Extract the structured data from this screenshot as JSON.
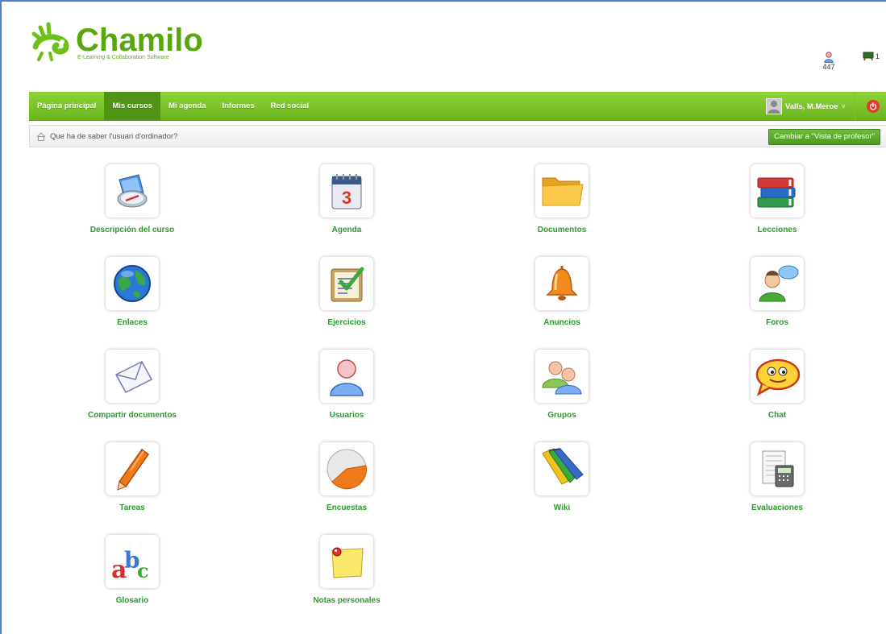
{
  "header": {
    "logo_name": "Chamilo",
    "logo_tagline": "E-Learning & Collaboration Software",
    "online_users": "447",
    "messages": "1"
  },
  "nav": {
    "items": [
      {
        "label": "Página principal",
        "active": false
      },
      {
        "label": "Mis cursos",
        "active": true
      },
      {
        "label": "Mi agenda",
        "active": false
      },
      {
        "label": "Informes",
        "active": false
      },
      {
        "label": "Red social",
        "active": false
      }
    ],
    "user_name": "Valls, M.Meroe",
    "user_caret": "˅"
  },
  "breadcrumb": {
    "course_title": "Que ha de saber l'usuari d'ordinador?",
    "switch_label": "Cambiar a \"Vista de profesor\""
  },
  "tools": [
    {
      "label": "Descripción del curso",
      "icon": "course-description-icon"
    },
    {
      "label": "Agenda",
      "icon": "agenda-icon"
    },
    {
      "label": "Documentos",
      "icon": "documents-icon"
    },
    {
      "label": "Lecciones",
      "icon": "lessons-icon"
    },
    {
      "label": "Enlaces",
      "icon": "links-icon"
    },
    {
      "label": "Ejercicios",
      "icon": "exercises-icon"
    },
    {
      "label": "Anuncios",
      "icon": "announcements-icon"
    },
    {
      "label": "Foros",
      "icon": "forums-icon"
    },
    {
      "label": "Compartir documentos",
      "icon": "dropbox-icon"
    },
    {
      "label": "Usuarios",
      "icon": "users-icon"
    },
    {
      "label": "Grupos",
      "icon": "groups-icon"
    },
    {
      "label": "Chat",
      "icon": "chat-icon"
    },
    {
      "label": "Tareas",
      "icon": "assignments-icon"
    },
    {
      "label": "Encuestas",
      "icon": "surveys-icon"
    },
    {
      "label": "Wiki",
      "icon": "wiki-icon"
    },
    {
      "label": "Evaluaciones",
      "icon": "gradebook-icon"
    },
    {
      "label": "Glosario",
      "icon": "glossary-icon"
    },
    {
      "label": "Notas personales",
      "icon": "notebook-icon"
    }
  ],
  "colors": {
    "brand_green": "#57a80c",
    "nav_green": "#7cc22b",
    "label_green": "#2a9b2a",
    "frame_blue": "#4a7fd4"
  }
}
